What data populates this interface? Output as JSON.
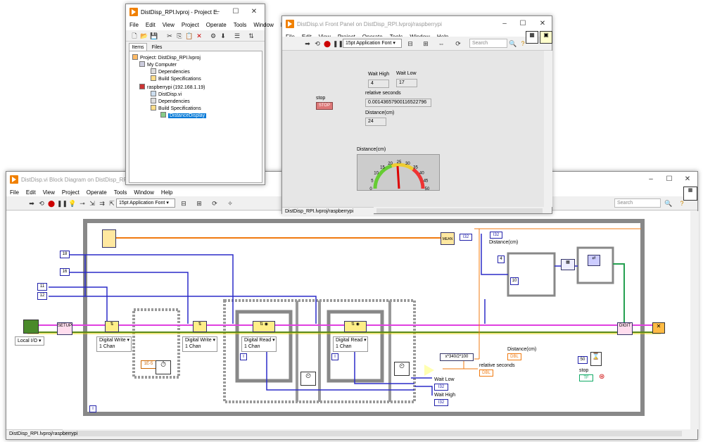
{
  "block": {
    "title": "DistDisp.vi Block Diagram on DistDisp_RPI.lvproj/r",
    "menu": [
      "File",
      "Edit",
      "View",
      "Project",
      "Operate",
      "Tools",
      "Window",
      "Help"
    ],
    "font": "15pt Application Font",
    "search": "Search",
    "status": "DistDisp_RPI.lvproj/raspberrypi",
    "consts": {
      "c18": "18",
      "c16": "16",
      "c11": "11",
      "c12": "12",
      "c50": "50",
      "c4": "4",
      "c10": "10",
      "delay": "1E-5"
    },
    "local_io": "Local I/O",
    "setup": "SETUP",
    "digit": "DIGIT",
    "mean": "MEAN",
    "digital_write": "Digital Write",
    "digital_read": "Digital Read",
    "one_chan": "1 Chan",
    "formula": "x*340/2*100",
    "i32": "I32",
    "dbl": "DBL",
    "tf": "TF",
    "labels": {
      "distance": "Distance(cm)",
      "distance2": "Distance(cm)",
      "relative": "relative seconds",
      "wait_low": "Wait Low",
      "wait_high": "Wait High",
      "stop": "stop"
    }
  },
  "project": {
    "title": "DistDisp_RPI.lvproj - Project E...",
    "menu": [
      "File",
      "Edit",
      "View",
      "Project",
      "Operate",
      "Tools",
      "Window",
      "He"
    ],
    "tabs": [
      "Items",
      "Files"
    ],
    "tree": [
      "Project: DistDisp_RPI.lvproj",
      "My Computer",
      "Dependencies",
      "Build Specifications",
      "raspberrypi (192.168.1.19)",
      "DistDisp.vi",
      "Dependencies",
      "Build Specifications",
      "DistanceDisplay"
    ]
  },
  "front": {
    "title": "DistDisp.vi Front Panel on DistDisp_RPI.lvproj/raspberrypi",
    "menu": [
      "File",
      "Edit",
      "View",
      "Project",
      "Operate",
      "Tools",
      "Window",
      "Help"
    ],
    "font": "15pt Application Font",
    "search": "Search",
    "status": "DistDisp_RPI.lvproj/raspberrypi",
    "stop_label": "stop",
    "stop_btn": "STOP",
    "wait_high_label": "Wait High",
    "wait_high": "4",
    "wait_low_label": "Wait Low",
    "wait_low": "17",
    "rel_label": "relative seconds",
    "rel": "0.00143657900116522796",
    "dist_label": "Distance(cm)",
    "dist": "24",
    "gauge_label": "Distance(cm)",
    "gauge_value": 24,
    "gauge_ticks": [
      "0",
      "5",
      "10",
      "15",
      "20",
      "25",
      "30",
      "35",
      "40",
      "45",
      "50"
    ]
  },
  "colors": {
    "orange": "#f08000",
    "wire_blue": "#2c2cc8",
    "wire_pink": "#e040e0",
    "wire_green": "#5a8a1a",
    "wire_orange": "#f07a10",
    "selected": "#0078d7"
  }
}
